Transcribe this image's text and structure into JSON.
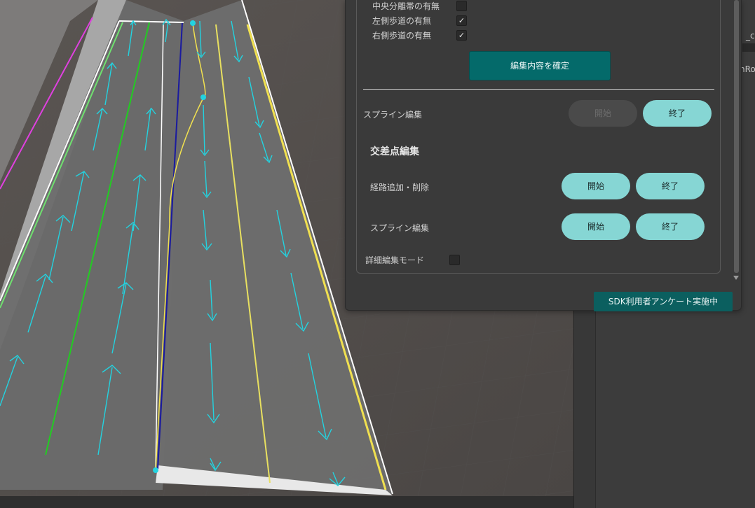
{
  "panel": {
    "checks": [
      {
        "label": "中央分離帯の有無",
        "checked": false
      },
      {
        "label": "左側歩道の有無",
        "checked": true
      },
      {
        "label": "右側歩道の有無",
        "checked": true
      }
    ],
    "confirm_label": "編集内容を確定",
    "spline_edit": {
      "label": "スプライン編集",
      "start": "開始",
      "end": "終了",
      "start_disabled": true
    },
    "intersection": {
      "heading": "交差点編集",
      "route_add_delete": {
        "label": "経路追加・削除",
        "start": "開始",
        "end": "終了"
      },
      "spline_edit": {
        "label": "スプライン編集",
        "start": "開始",
        "end": "終了"
      }
    },
    "detail_mode": {
      "label": "詳細編集モード",
      "checked": false
    },
    "survey_label": "SDK利用者アンケート実施中"
  },
  "inspector": {
    "frag_top": "_cit",
    "frag_mid": "nRoa"
  },
  "colors": {
    "accent": "#86d6d4",
    "confirm": "#046a6a",
    "survey": "#0b5f5f",
    "lane_arrow": "#23d3e0"
  }
}
